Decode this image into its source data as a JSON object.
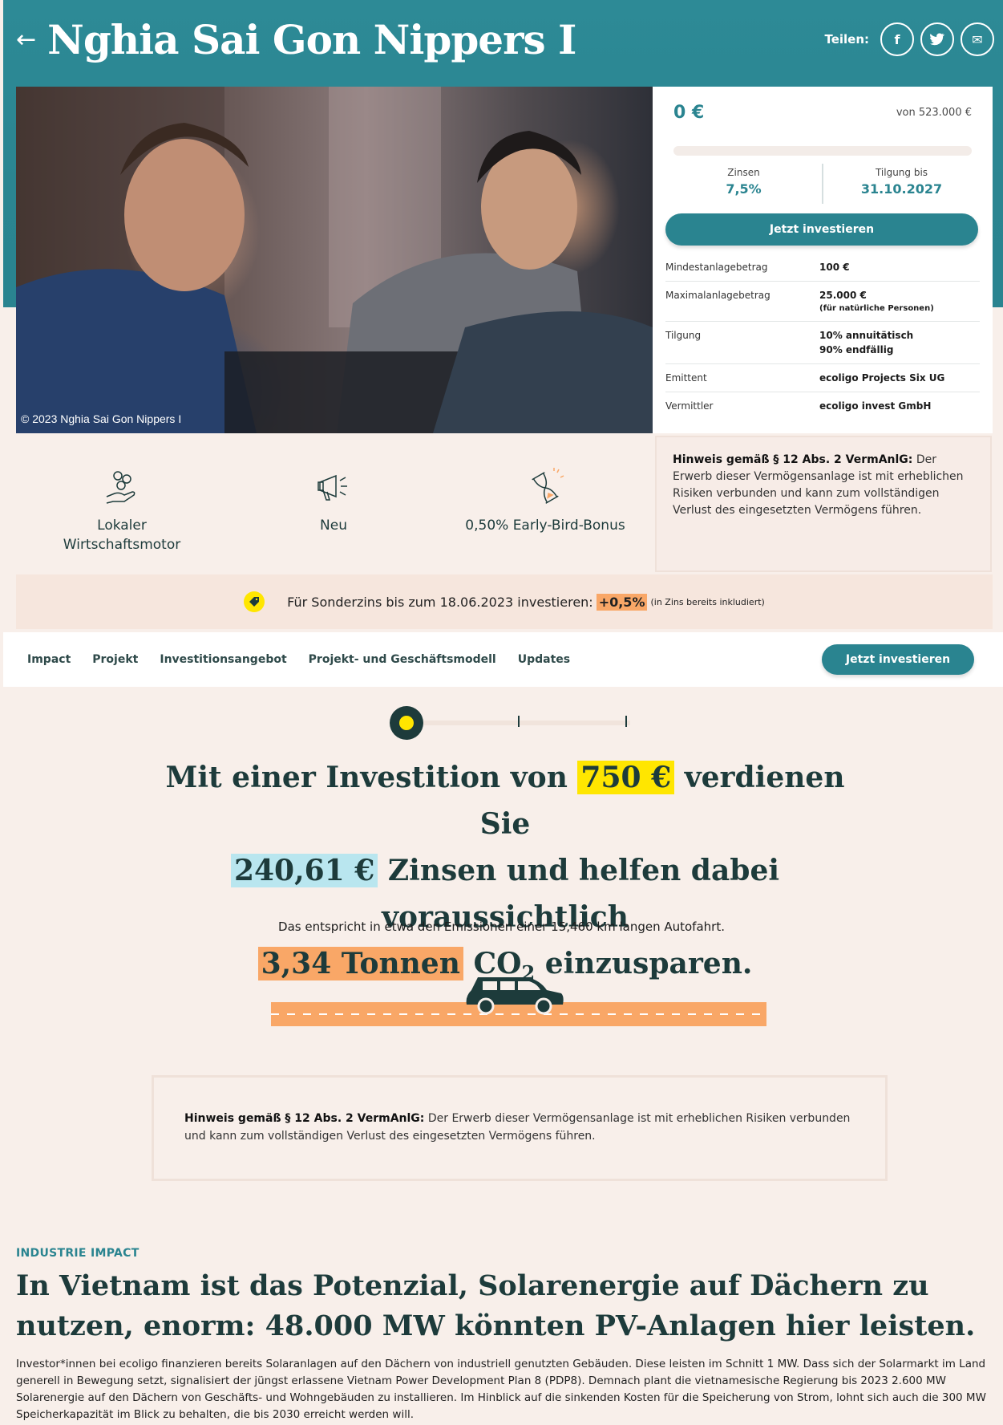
{
  "header": {
    "back_icon": "←",
    "title": "Nghia Sai Gon Nippers I",
    "share_label": "Teilen:",
    "share_buttons": [
      {
        "icon": "facebook-icon",
        "glyph": "f"
      },
      {
        "icon": "twitter-icon",
        "glyph": "🐦"
      },
      {
        "icon": "mail-icon",
        "glyph": "✉"
      }
    ]
  },
  "photo": {
    "credit": "© 2023 Nghia Sai Gon Nippers I"
  },
  "invest_card": {
    "current_amount": "0 €",
    "target_amount": "von 523.000 €",
    "progress": 0,
    "stats": [
      {
        "label": "Zinsen",
        "value": "7,5%"
      },
      {
        "label": "Tilgung bis",
        "value": "31.10.2027"
      }
    ],
    "button_label": "Jetzt investieren",
    "details": [
      {
        "key": "Mindestanlagebetrag",
        "value": "100 €",
        "sub": ""
      },
      {
        "key": "Maximalanlagebetrag",
        "value": "25.000 €",
        "sub": "(für natürliche Personen)"
      },
      {
        "key": "Tilgung",
        "value": "10% annuitätisch",
        "sub": "90% endfällig"
      },
      {
        "key": "Emittent",
        "value": "ecoligo Projects Six UG",
        "sub": ""
      },
      {
        "key": "Vermittler",
        "value": "ecoligo invest GmbH",
        "sub": ""
      }
    ]
  },
  "features": [
    {
      "icon": "money-hand-icon",
      "label": "Lokaler\nWirtschaftsmotor"
    },
    {
      "icon": "megaphone-icon",
      "label": "Neu"
    },
    {
      "icon": "hourglass-icon",
      "label": "0,50% Early-Bird-Bonus"
    }
  ],
  "notice": {
    "bold": "Hinweis gemäß § 12 Abs. 2 VermAnlG:",
    "text": " Der Erwerb dieser Vermögensanlage ist mit erheblichen Risiken verbunden und kann zum vollständigen Verlust des eingesetzten Vermögens führen."
  },
  "promo": {
    "icon": "tag-icon",
    "text": "Für Sonderzins bis zum 18.06.2023 investieren:",
    "highlight": "+0,5%",
    "note": "(in Zins bereits inkludiert)"
  },
  "nav": {
    "items": [
      "Impact",
      "Projekt",
      "Investitionsangebot",
      "Projekt- und Geschäftsmodell",
      "Updates"
    ],
    "button_label": "Jetzt investieren"
  },
  "impact": {
    "slider_level": 0,
    "part1": "Mit einer Investition von",
    "amount": "750 €",
    "part2": "verdienen Sie",
    "interest": "240,61 €",
    "part3": "Zinsen und helfen dabei voraussichtlich",
    "co2": "3,34 Tonnen",
    "part4_pre": "CO",
    "part4_sub": "2",
    "part4_post": " einzusparen.",
    "subline": "Das entspricht in etwa den Emissionen einer 15,460 km langen Autofahrt."
  },
  "section": {
    "kicker": "INDUSTRIE IMPACT",
    "title": "In Vietnam ist das Potenzial, Solarenergie auf Dächern zu nutzen, enorm: 48.000 MW könnten PV-Anlagen hier leisten.",
    "body": "Investor*innen bei ecoligo finanzieren bereits Solaranlagen auf den Dächern von industriell genutzten Gebäuden. Diese leisten im Schnitt 1 MW. Dass sich der Solarmarkt im Land generell in Bewegung setzt, signalisiert der jüngst erlassene Vietnam Power Development Plan 8 (PDP8). Demnach plant die vietnamesische Regierung bis 2023 2.600 MW Solarenergie auf den Dächern von Geschäfts- und Wohngebäuden zu installieren. Im Hinblick auf die sinkenden Kosten für die Speicherung von Strom, lohnt sich auch die 300 MW Speicherkapazität im Blick zu behalten, die bis 2030 erreicht werden will."
  }
}
